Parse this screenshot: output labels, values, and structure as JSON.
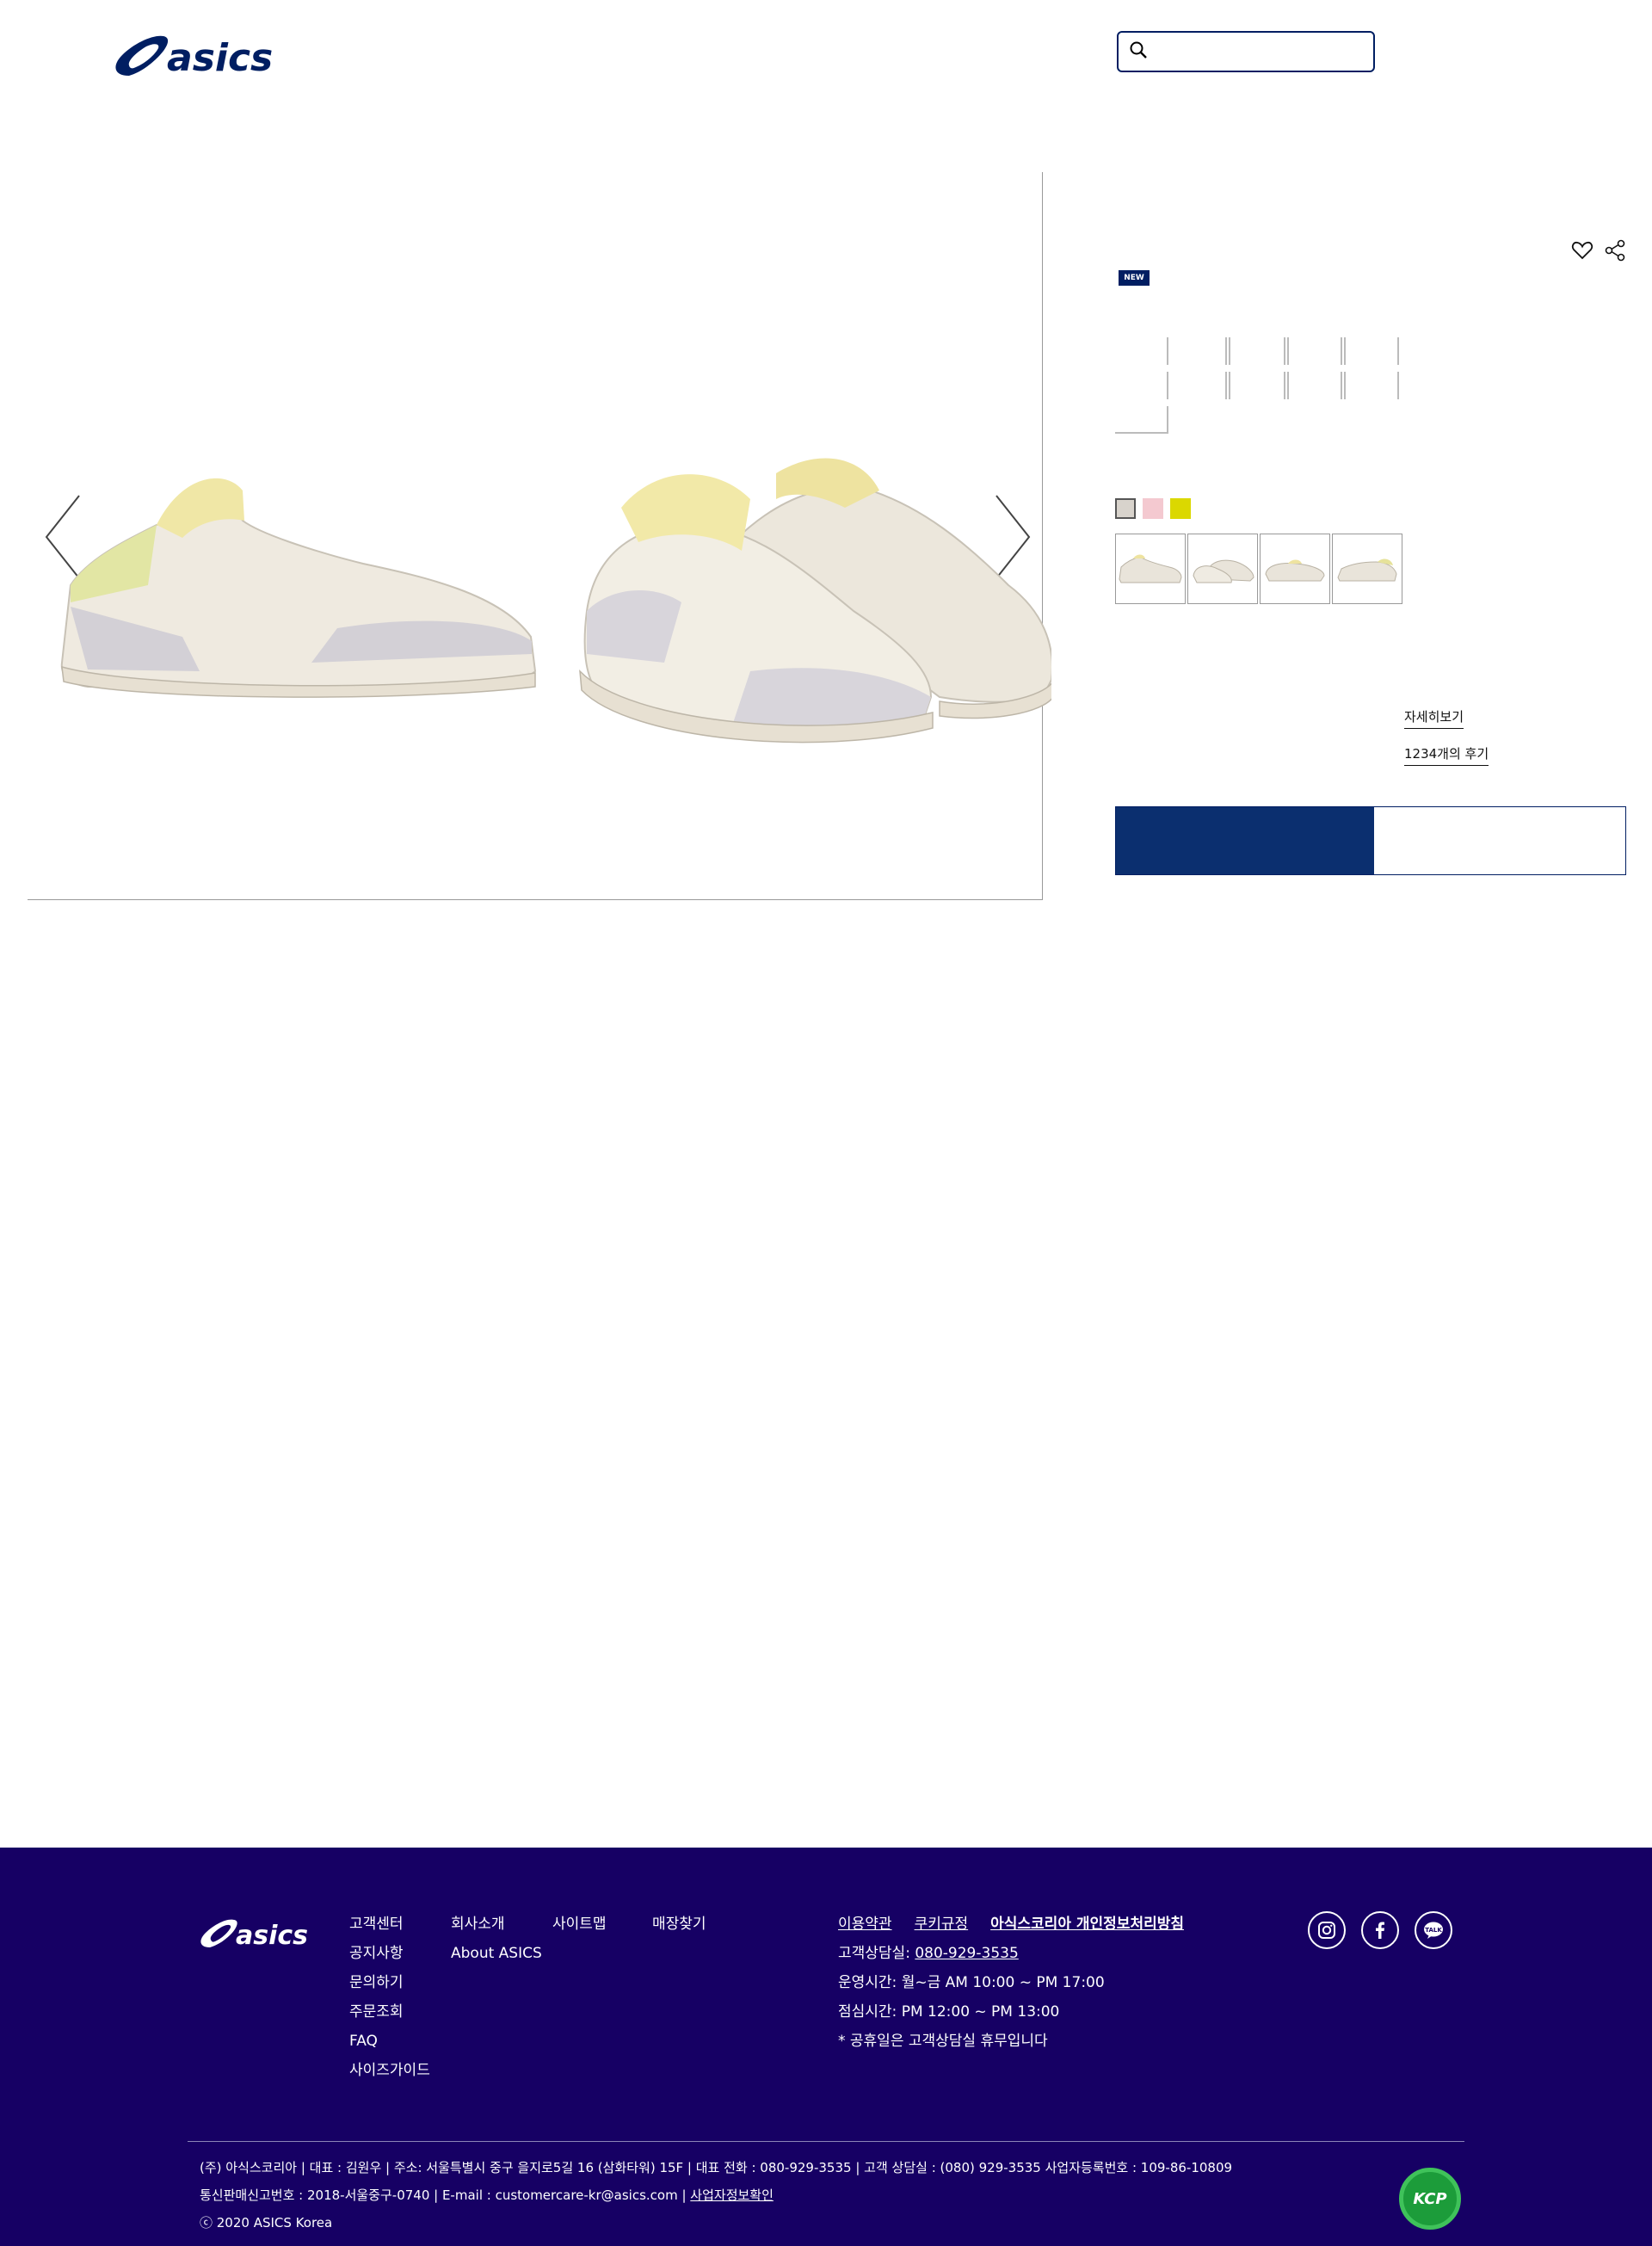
{
  "header": {
    "logo_text": "asics",
    "search": {
      "placeholder": "",
      "value": ""
    }
  },
  "product": {
    "badge": "NEW",
    "colors": [
      "#d8d3cc",
      "#f4c9d0",
      "#dbd800"
    ],
    "detail_link": "자세히보기",
    "review_link": "1234개의 후기"
  },
  "footer": {
    "logo_text": "asics",
    "col1": [
      "고객센터",
      "공지사항",
      "문의하기",
      "주문조회",
      "FAQ",
      "사이즈가이드"
    ],
    "col2": [
      "회사소개",
      "About ASICS"
    ],
    "col3": [
      "사이트맵"
    ],
    "col4": [
      "매장찾기"
    ],
    "legal": {
      "terms": "이용약관",
      "cookie": "쿠키규정",
      "privacy": "아식스코리아 개인정보처리방침"
    },
    "info": {
      "phone_label": "고객상담실:",
      "phone": "080-929-3535",
      "hours": "운영시간: 월~금 AM 10:00 ~ PM 17:00",
      "lunch": "점심시간: PM 12:00 ~ PM 13:00",
      "holiday": "* 공휴일은 고객상담실 휴무입니다"
    },
    "address_line1": "(주) 아식스코리아 |  대표 : 김원우  |  주소: 서울특별시 중구 을지로5길 16 (삼화타워) 15F  |  대표 전화 : 080-929-3535  |  고객 상담실 : (080) 929-3535 사업자등록번호 : 109-86-10809",
    "address_line2": "통신판매신고번호 : 2018-서울중구-0740 |  E-mail : customercare-kr@asics.com  |",
    "verify_link": "사업자정보확인",
    "copyright": "ⓒ 2020 ASICS Korea",
    "kcp": "KCP"
  }
}
